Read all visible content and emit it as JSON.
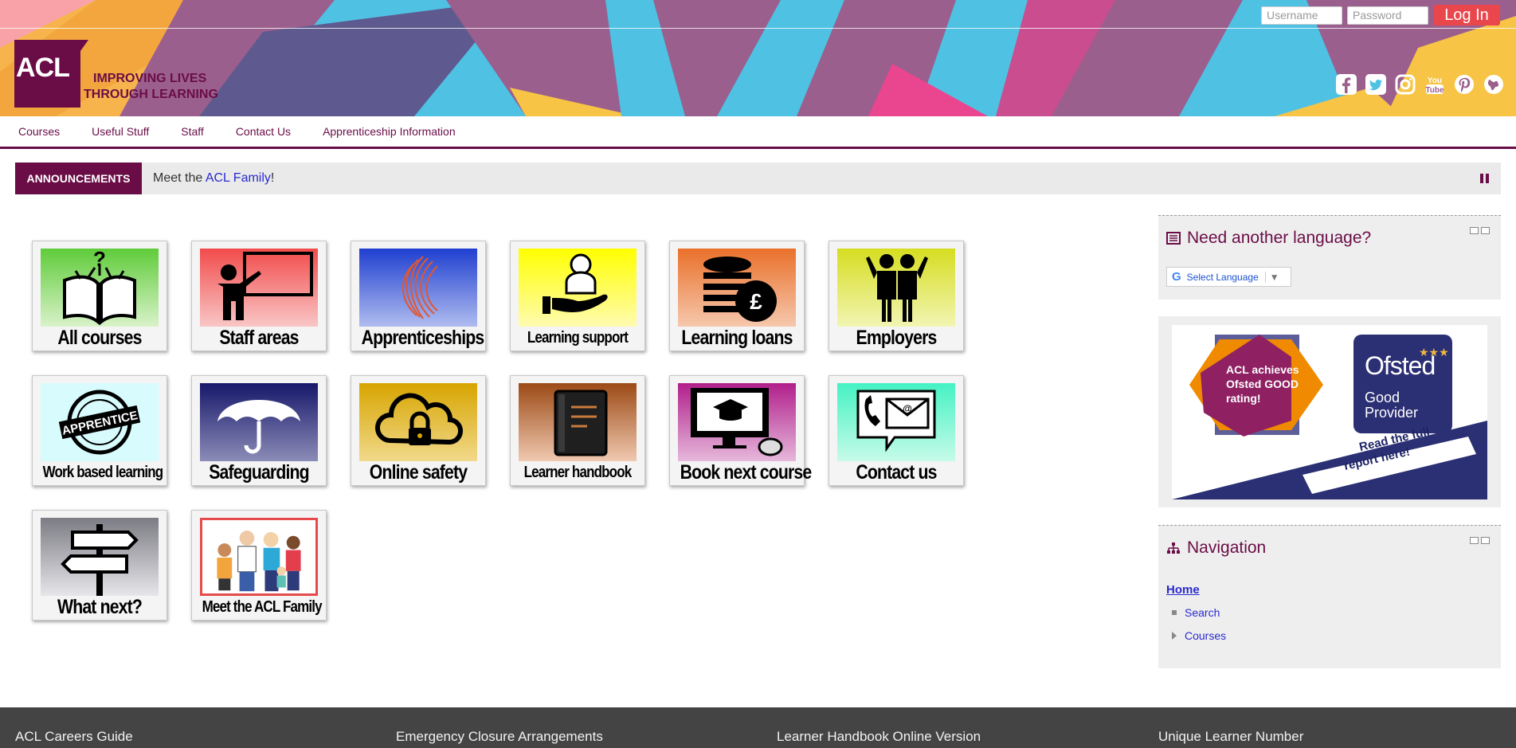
{
  "header": {
    "logo_text": "ACL",
    "tagline_line1": "IMPROVING LIVES",
    "tagline_line2": "THROUGH LEARNING",
    "login": {
      "username_placeholder": "Username",
      "password_placeholder": "Password",
      "login_label": "Log In"
    },
    "social": [
      "facebook-icon",
      "twitter-icon",
      "instagram-icon",
      "youtube-icon",
      "pinterest-icon",
      "globe-icon"
    ]
  },
  "nav": {
    "items": [
      "Courses",
      "Useful Stuff",
      "Staff",
      "Contact Us",
      "Apprenticeship Information"
    ]
  },
  "announcements": {
    "label": "ANNOUNCEMENTS",
    "prefix": "Meet the ",
    "link": "ACL Family",
    "suffix": "!"
  },
  "tiles": [
    {
      "label": "All courses",
      "color": "#5fcc3a"
    },
    {
      "label": "Staff areas",
      "color": "#f24b4b"
    },
    {
      "label": "Apprenticeships",
      "color": "#1f3fd0"
    },
    {
      "label": "Learning support",
      "color": "#ffff00"
    },
    {
      "label": "Learning loans",
      "color": "#e9702a"
    },
    {
      "label": "Employers",
      "color": "#d6dd20"
    },
    {
      "label": "Work based learning",
      "color": "#b5f3f6"
    },
    {
      "label": "Safeguarding",
      "color": "#17186a"
    },
    {
      "label": "Online safety",
      "color": "#d7a500"
    },
    {
      "label": "Learner handbook",
      "color": "#9c4a16"
    },
    {
      "label": "Book next course",
      "color": "#b11f8b"
    },
    {
      "label": "Contact us",
      "color": "#45f2c3"
    },
    {
      "label": "What next?",
      "color": "#7c7c84"
    },
    {
      "label": "Meet the ACL Family",
      "color": "#ffffff"
    }
  ],
  "sidebar": {
    "language": {
      "title": "Need another language?",
      "select_label": "Select Language"
    },
    "ofsted": {
      "badge_line1": "ACL achieves",
      "badge_line2": "Ofsted GOOD",
      "badge_line3": "rating!",
      "brand": "Ofsted",
      "grade_line1": "Good",
      "grade_line2": "Provider",
      "cta_line1": "Read the full",
      "cta_line2": "report here!"
    },
    "navigation": {
      "title": "Navigation",
      "home": "Home",
      "items": [
        "Search",
        "Courses"
      ]
    }
  },
  "footer": {
    "links": [
      "ACL Careers Guide",
      "Emergency Closure Arrangements",
      "Learner Handbook Online Version",
      "Unique Learner Number"
    ]
  },
  "colors": {
    "brand_plum": "#6a0d47",
    "login_red": "#e9474c",
    "link_blue": "#2a2ad0",
    "footer_grey": "#444444"
  }
}
